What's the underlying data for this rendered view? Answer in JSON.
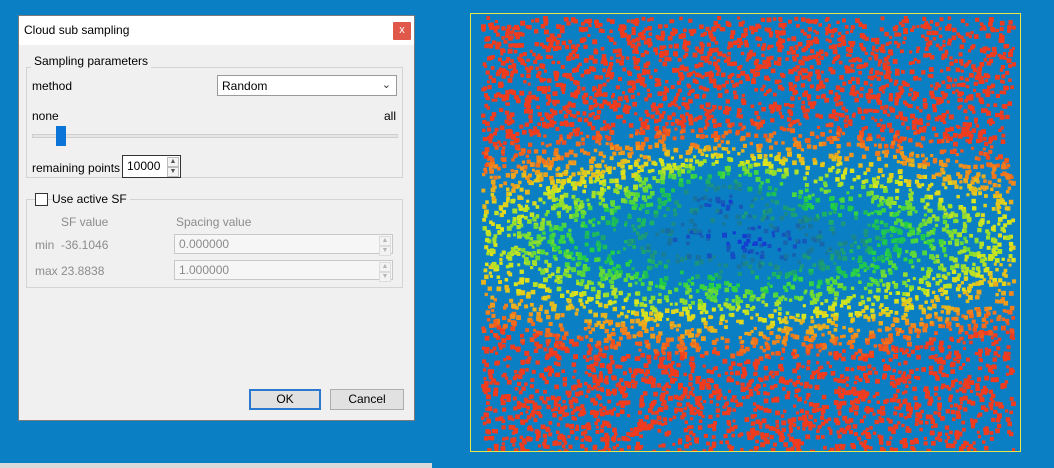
{
  "dialog": {
    "title": "Cloud sub sampling",
    "close_glyph": "x",
    "sampling_group_title": "Sampling parameters",
    "method_label": "method",
    "method_value": "Random",
    "slider_min_label": "none",
    "slider_max_label": "all",
    "slider_level": 0.04,
    "remaining_label": "remaining points",
    "remaining_value": "10000",
    "use_active_sf_label": "Use active SF",
    "use_active_sf_checked": false,
    "sf_value_header": "SF value",
    "spacing_value_header": "Spacing value",
    "min_label": "min",
    "min_sf": "-36.1046",
    "min_spacing": "0.000000",
    "max_label": "max",
    "max_sf": "23.8838",
    "max_spacing": "1.000000",
    "ok_label": "OK",
    "cancel_label": "Cancel"
  },
  "viewport": {
    "description_icon": "point-cloud",
    "colors": {
      "background": "#0a7fc4",
      "frame": "#e8e84a",
      "low": "#1a3fd6",
      "mid": "#2fd63a",
      "high": "#e8431a"
    }
  }
}
